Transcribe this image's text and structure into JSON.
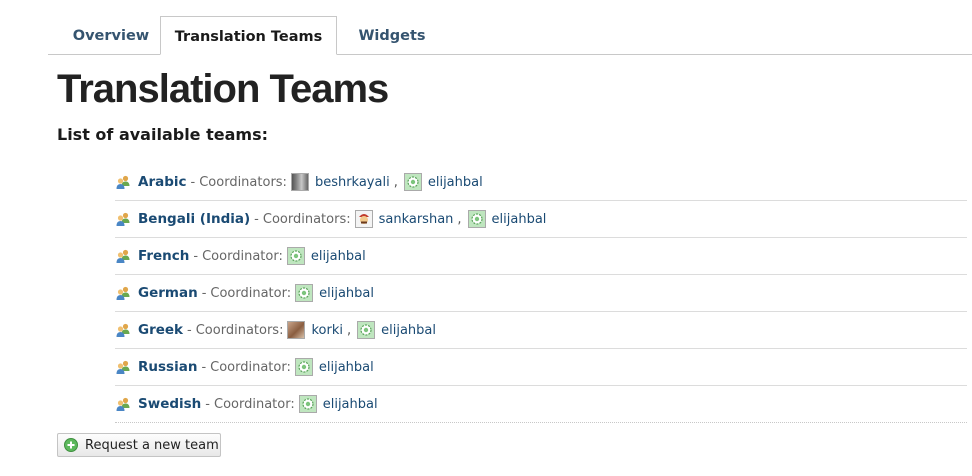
{
  "tabs": [
    {
      "label": "Overview",
      "active": false
    },
    {
      "label": "Translation Teams",
      "active": true
    },
    {
      "label": "Widgets",
      "active": false
    }
  ],
  "page_title": "Translation Teams",
  "subtitle": "List of available teams:",
  "separator": "-",
  "teams": [
    {
      "name": "Arabic",
      "coord_label": "Coordinators:",
      "coordinators": [
        {
          "name": "beshrkayali",
          "avatar": "photo-gray"
        },
        {
          "name": "elijahbal",
          "avatar": "default"
        }
      ]
    },
    {
      "name": "Bengali (India)",
      "coord_label": "Coordinators:",
      "coordinators": [
        {
          "name": "sankarshan",
          "avatar": "face"
        },
        {
          "name": "elijahbal",
          "avatar": "default"
        }
      ]
    },
    {
      "name": "French",
      "coord_label": "Coordinator:",
      "coordinators": [
        {
          "name": "elijahbal",
          "avatar": "default"
        }
      ]
    },
    {
      "name": "German",
      "coord_label": "Coordinator:",
      "coordinators": [
        {
          "name": "elijahbal",
          "avatar": "default"
        }
      ]
    },
    {
      "name": "Greek",
      "coord_label": "Coordinators:",
      "coordinators": [
        {
          "name": "korki",
          "avatar": "photo-brown"
        },
        {
          "name": "elijahbal",
          "avatar": "default"
        }
      ]
    },
    {
      "name": "Russian",
      "coord_label": "Coordinator:",
      "coordinators": [
        {
          "name": "elijahbal",
          "avatar": "default"
        }
      ]
    },
    {
      "name": "Swedish",
      "coord_label": "Coordinator:",
      "coordinators": [
        {
          "name": "elijahbal",
          "avatar": "default"
        }
      ]
    }
  ],
  "comma": ",",
  "request_button": {
    "label": "Request a new team",
    "icon": "plus-circle-icon"
  },
  "colors": {
    "link": "#1a4a73",
    "tab_link": "#35546f",
    "border": "#c8c8c8",
    "add_green": "#5cb85c"
  }
}
